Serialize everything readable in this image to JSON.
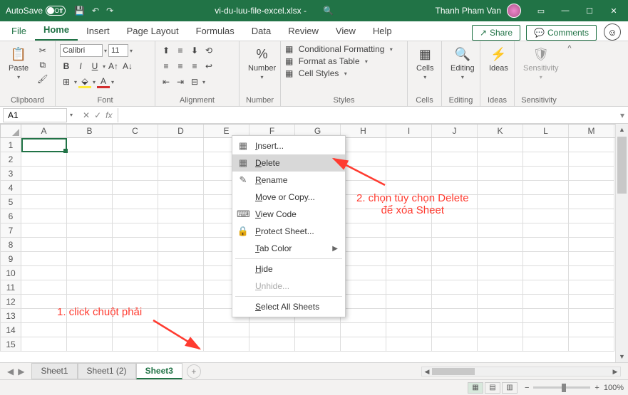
{
  "titlebar": {
    "autosave_label": "AutoSave",
    "autosave_state": "Off",
    "filename": "vi-du-luu-file-excel.xlsx  -",
    "user": "Thanh Pham Van"
  },
  "menu": {
    "file": "File",
    "home": "Home",
    "insert": "Insert",
    "page_layout": "Page Layout",
    "formulas": "Formulas",
    "data": "Data",
    "review": "Review",
    "view": "View",
    "help": "Help",
    "share": "Share",
    "comments": "Comments"
  },
  "ribbon": {
    "clipboard": {
      "paste": "Paste",
      "label": "Clipboard"
    },
    "font": {
      "name": "Calibri",
      "size": "11",
      "label": "Font"
    },
    "alignment": {
      "label": "Alignment"
    },
    "number": {
      "btn": "Number",
      "label": "Number"
    },
    "styles": {
      "cond": "Conditional Formatting",
      "table": "Format as Table",
      "cell": "Cell Styles",
      "label": "Styles"
    },
    "cells": {
      "btn": "Cells",
      "label": "Cells"
    },
    "editing": {
      "btn": "Editing",
      "label": "Editing"
    },
    "ideas": {
      "btn": "Ideas",
      "label": "Ideas"
    },
    "sensitivity": {
      "btn": "Sensitivity",
      "label": "Sensitivity"
    }
  },
  "formula": {
    "cell": "A1",
    "fx": "fx"
  },
  "columns": [
    "A",
    "B",
    "C",
    "D",
    "E",
    "F",
    "G",
    "H",
    "I",
    "J",
    "K",
    "L",
    "M"
  ],
  "rows": [
    "1",
    "2",
    "3",
    "4",
    "5",
    "6",
    "7",
    "8",
    "9",
    "10",
    "11",
    "12",
    "13",
    "14",
    "15"
  ],
  "sheets": {
    "tabs": [
      "Sheet1",
      "Sheet1 (2)",
      "Sheet3"
    ],
    "active": 2
  },
  "context_menu": {
    "insert": "Insert...",
    "delete": "Delete",
    "rename": "Rename",
    "move_copy": "Move or Copy...",
    "view_code": "View Code",
    "protect": "Protect Sheet...",
    "tab_color": "Tab Color",
    "hide": "Hide",
    "unhide": "Unhide...",
    "select_all": "Select All Sheets"
  },
  "status": {
    "zoom": "100%"
  },
  "annotations": {
    "step1": "1. click chuột phải",
    "step2a": "2. chọn tùy chọn Delete",
    "step2b": "để xóa Sheet"
  }
}
